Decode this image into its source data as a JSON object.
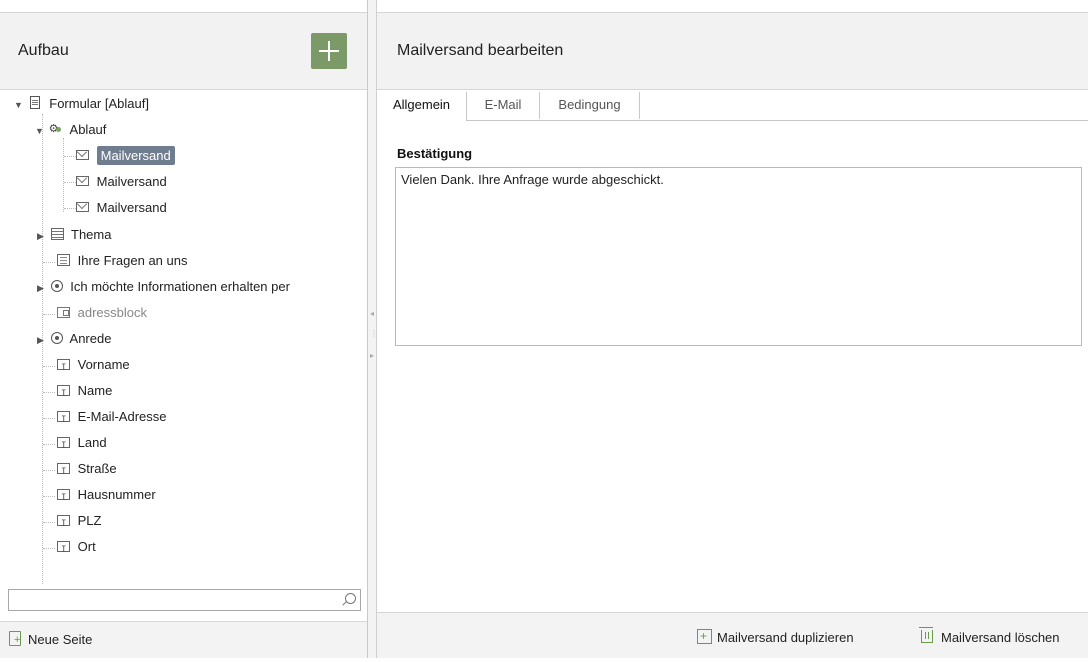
{
  "left": {
    "title": "Aufbau",
    "add_button_icon": "plus-icon",
    "tree": [
      {
        "label": "Formular [Ablauf]",
        "icon": "form-icon",
        "expanded": true
      },
      {
        "label": "Ablauf",
        "icon": "workflow-icon",
        "expanded": true
      },
      {
        "label": "Mailversand",
        "icon": "mail-icon",
        "selected": true
      },
      {
        "label": "Mailversand",
        "icon": "mail-icon"
      },
      {
        "label": "Mailversand",
        "icon": "mail-icon"
      },
      {
        "label": "Thema",
        "icon": "table-icon",
        "expanded": false
      },
      {
        "label": "Ihre Fragen an uns",
        "icon": "textarea-icon"
      },
      {
        "label": "Ich möchte Informationen erhalten per",
        "icon": "radio-icon",
        "expanded": false
      },
      {
        "label": "adressblock",
        "icon": "address-block-icon",
        "muted": true
      },
      {
        "label": "Anrede",
        "icon": "radio-icon",
        "expanded": false
      },
      {
        "label": "Vorname",
        "icon": "text-field-icon"
      },
      {
        "label": "Name",
        "icon": "text-field-icon"
      },
      {
        "label": "E-Mail-Adresse",
        "icon": "text-field-icon"
      },
      {
        "label": "Land",
        "icon": "text-field-icon"
      },
      {
        "label": "Straße",
        "icon": "text-field-icon"
      },
      {
        "label": "Hausnummer",
        "icon": "text-field-icon"
      },
      {
        "label": "PLZ",
        "icon": "text-field-icon"
      },
      {
        "label": "Ort",
        "icon": "text-field-icon"
      }
    ],
    "search_value": "",
    "new_page_label": "Neue Seite"
  },
  "right": {
    "title": "Mailversand bearbeiten",
    "tabs": [
      {
        "label": "Allgemein",
        "active": true
      },
      {
        "label": "E-Mail",
        "active": false
      },
      {
        "label": "Bedingung",
        "active": false
      }
    ],
    "confirmation_label": "Bestätigung",
    "confirmation_text": "Vielen Dank. Ihre Anfrage wurde abgeschickt.",
    "duplicate_label": "Mailversand duplizieren",
    "delete_label": "Mailversand löschen"
  },
  "colors": {
    "accent_green": "#7b9a68",
    "selection": "#6f7d8f",
    "panel_bg": "#f2f2f2"
  }
}
